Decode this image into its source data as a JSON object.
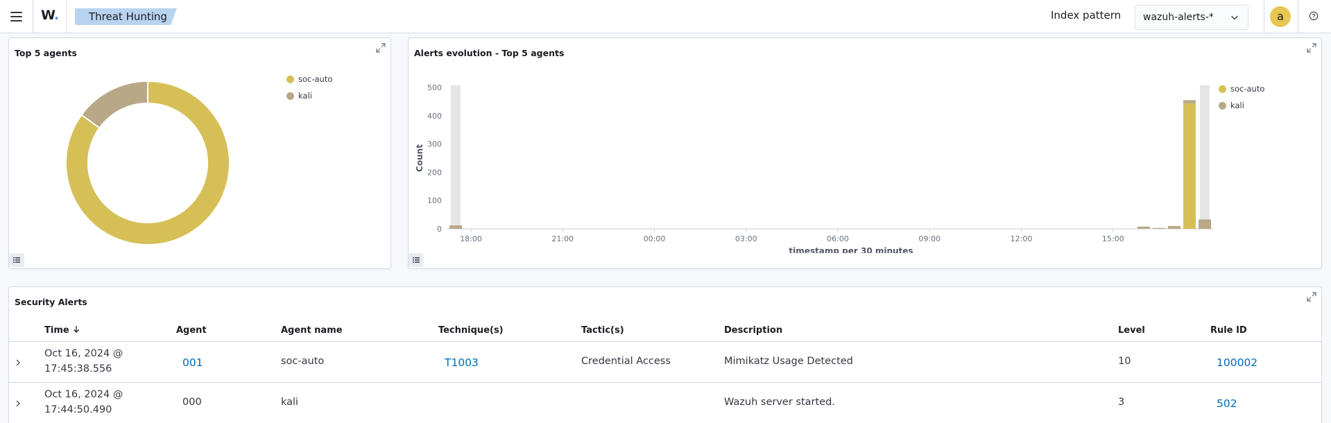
{
  "header": {
    "logo_text": "W",
    "logo_dot": ".",
    "breadcrumb": "Threat Hunting",
    "index_pattern_label": "Index pattern",
    "index_pattern_value": "wazuh-alerts-*",
    "avatar_initial": "a"
  },
  "colors": {
    "soc_auto": "#d6bf57",
    "kali": "#b9a888",
    "link": "#006bb8"
  },
  "top_agents": {
    "title": "Top 5 agents",
    "legend": [
      {
        "label": "soc-auto",
        "color": "#d6bf57"
      },
      {
        "label": "kali",
        "color": "#b9a888"
      }
    ]
  },
  "alerts_evolution": {
    "title": "Alerts evolution - Top 5 agents",
    "legend": [
      {
        "label": "soc-auto",
        "color": "#d6bf57"
      },
      {
        "label": "kali",
        "color": "#b9a888"
      }
    ]
  },
  "chart_data": [
    {
      "type": "pie",
      "title": "Top 5 agents",
      "donut": true,
      "categories": [
        "soc-auto",
        "kali"
      ],
      "values": [
        85,
        15
      ],
      "colors": [
        "#d6bf57",
        "#b9a888"
      ],
      "legend_position": "top-right"
    },
    {
      "type": "bar",
      "stacked": true,
      "title": "Alerts evolution - Top 5 agents",
      "xlabel": "timestamp per 30 minutes",
      "ylabel": "Count",
      "ylim": [
        0,
        500
      ],
      "yticks": [
        0,
        100,
        200,
        300,
        400,
        500
      ],
      "xticks": [
        "18:00",
        "21:00",
        "00:00",
        "03:00",
        "06:00",
        "09:00",
        "12:00",
        "15:00"
      ],
      "legend_position": "top-right",
      "bars": [
        {
          "t": "17:30",
          "soc-auto": 0,
          "kali": 12
        },
        {
          "t": "16:00",
          "soc-auto": 0,
          "kali": 8
        },
        {
          "t": "16:30",
          "soc-auto": 0,
          "kali": 3
        },
        {
          "t": "17:00",
          "soc-auto": 0,
          "kali": 10
        },
        {
          "t": "17:30",
          "soc-auto": 443,
          "kali": 12
        },
        {
          "t": "18:00",
          "soc-auto": 0,
          "kali": 33
        }
      ],
      "series": [
        {
          "name": "soc-auto",
          "color": "#d6bf57"
        },
        {
          "name": "kali",
          "color": "#b9a888"
        }
      ],
      "highlight_bands": [
        "17:30",
        "18:00"
      ]
    }
  ],
  "security_alerts": {
    "title": "Security Alerts",
    "columns": [
      "Time",
      "Agent",
      "Agent name",
      "Technique(s)",
      "Tactic(s)",
      "Description",
      "Level",
      "Rule ID"
    ],
    "rows": [
      {
        "time_line1": "Oct 16, 2024 @",
        "time_line2": "17:45:38.556",
        "agent": "001",
        "agent_name": "soc-auto",
        "technique": "T1003",
        "tactic": "Credential Access",
        "description": "Mimikatz Usage Detected",
        "level": "10",
        "rule_id": "100002"
      },
      {
        "time_line1": "Oct 16, 2024 @",
        "time_line2": "17:44:50.490",
        "agent": "000",
        "agent_name": "kali",
        "technique": "",
        "tactic": "",
        "description": "Wazuh server started.",
        "level": "3",
        "rule_id": "502"
      }
    ]
  }
}
